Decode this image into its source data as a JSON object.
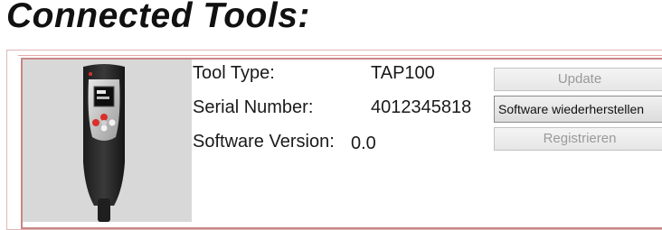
{
  "page": {
    "heading": "Connected Tools:"
  },
  "tool": {
    "type_label": "Tool Type:",
    "type_value": "TAP100",
    "serial_label": "Serial Number:",
    "serial_value": "4012345818",
    "version_label": "Software Version:",
    "version_value": "0.0"
  },
  "actions": {
    "update_label": "Update",
    "restore_label": "Software wiederherstellen",
    "register_label": "Registrieren"
  },
  "colors": {
    "card_border": "#c98686",
    "disabled_text": "#9a9a9a",
    "device_body": "#2b2b2b",
    "device_accent": "#d9302c"
  },
  "icons": {
    "device": "tap100-tool-image"
  }
}
